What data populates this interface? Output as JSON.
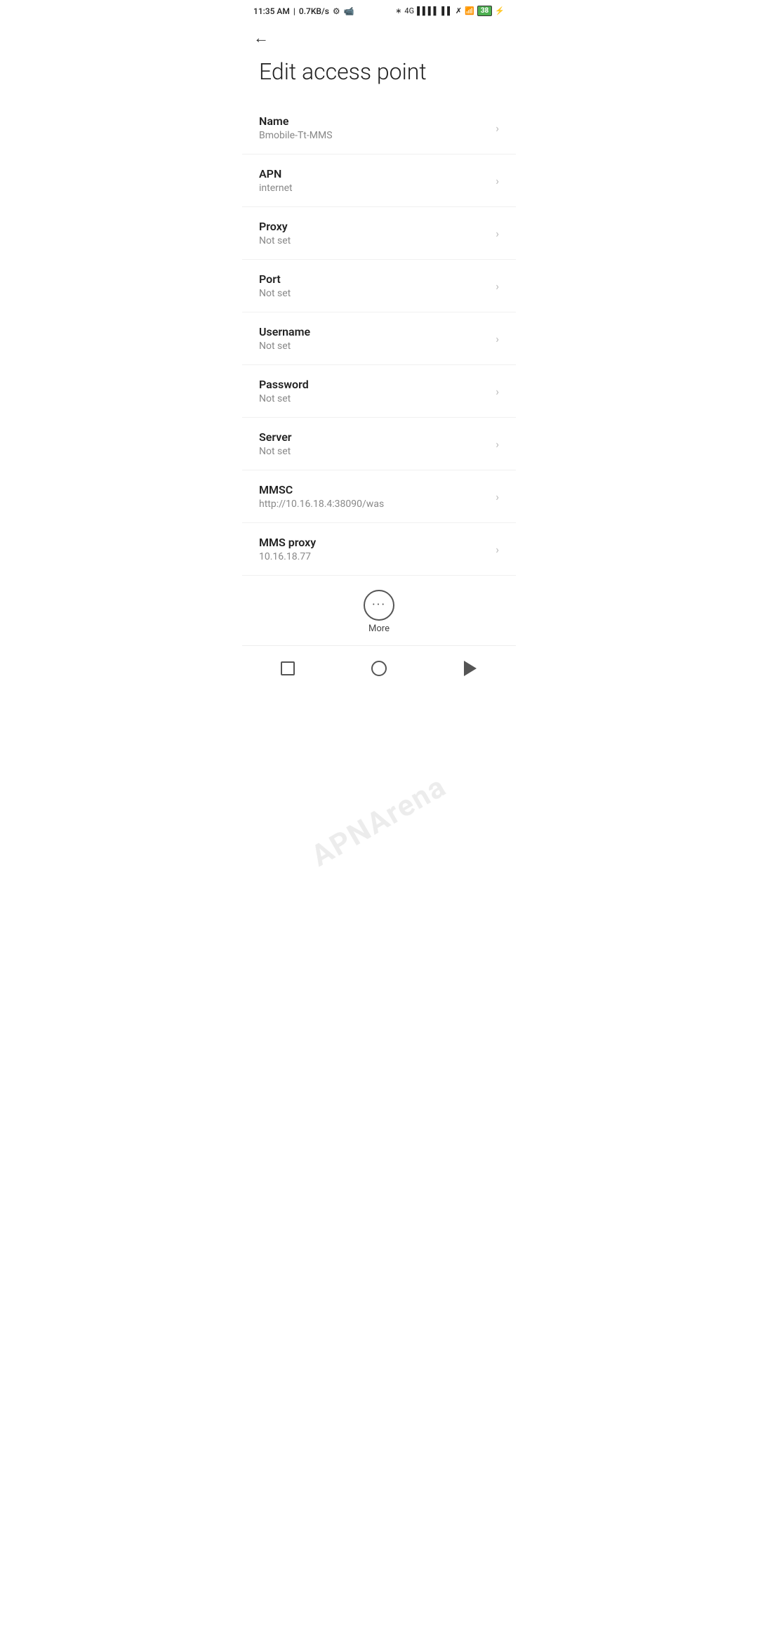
{
  "statusBar": {
    "time": "11:35 AM",
    "speed": "0.7KB/s",
    "bluetooth": "⚡",
    "battery": "38"
  },
  "header": {
    "backLabel": "←",
    "title": "Edit access point"
  },
  "settings": [
    {
      "label": "Name",
      "value": "Bmobile-Tt-MMS"
    },
    {
      "label": "APN",
      "value": "internet"
    },
    {
      "label": "Proxy",
      "value": "Not set"
    },
    {
      "label": "Port",
      "value": "Not set"
    },
    {
      "label": "Username",
      "value": "Not set"
    },
    {
      "label": "Password",
      "value": "Not set"
    },
    {
      "label": "Server",
      "value": "Not set"
    },
    {
      "label": "MMSC",
      "value": "http://10.16.18.4:38090/was"
    },
    {
      "label": "MMS proxy",
      "value": "10.16.18.77"
    }
  ],
  "more": {
    "label": "More"
  },
  "watermark": "APNArena"
}
